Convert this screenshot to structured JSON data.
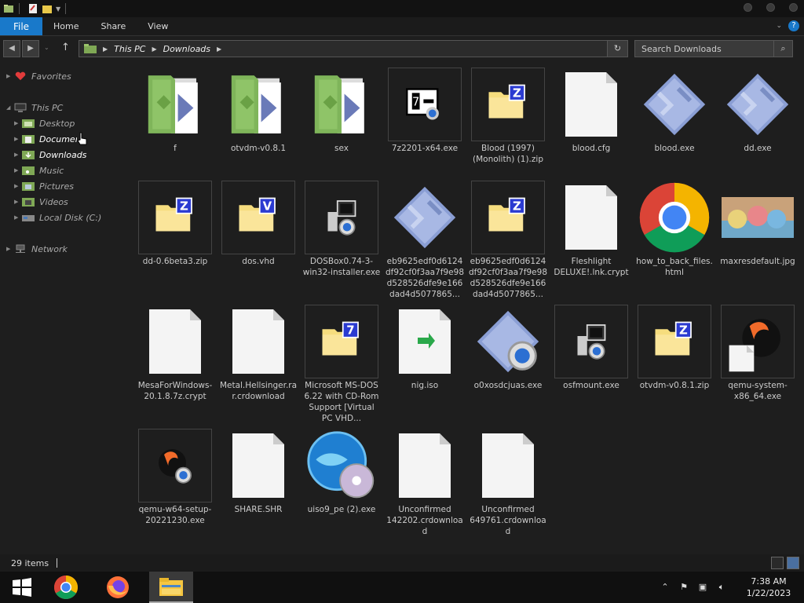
{
  "ribbon": {
    "file": "File",
    "home": "Home",
    "share": "Share",
    "view": "View"
  },
  "address": {
    "root": "This PC",
    "folder": "Downloads"
  },
  "search": {
    "placeholder": "Search Downloads"
  },
  "sidebar": {
    "favorites": "Favorites",
    "this_pc": "This PC",
    "desktop": "Desktop",
    "documents": "Documents",
    "downloads": "Downloads",
    "music": "Music",
    "pictures": "Pictures",
    "videos": "Videos",
    "local_disk": "Local Disk (C:)",
    "network": "Network"
  },
  "files": [
    {
      "name": "f",
      "type": "folder"
    },
    {
      "name": "otvdm-v0.8.1",
      "type": "folder"
    },
    {
      "name": "sex",
      "type": "folder"
    },
    {
      "name": "7z2201-x64.exe",
      "type": "7z-installer"
    },
    {
      "name": "Blood (1997)(Monolith) (1).zip",
      "type": "zip"
    },
    {
      "name": "blood.cfg",
      "type": "blank"
    },
    {
      "name": "blood.exe",
      "type": "exe"
    },
    {
      "name": "dd.exe",
      "type": "exe"
    },
    {
      "name": "dd-0.6beta3.zip",
      "type": "zip"
    },
    {
      "name": "dos.vhd",
      "type": "vhd"
    },
    {
      "name": "DOSBox0.74-3-win32-installer.exe",
      "type": "installer"
    },
    {
      "name": "eb9625edf0d6124df92cf0f3aa7f9e98d528526dfe9e166dad4d5077865...",
      "type": "exe"
    },
    {
      "name": "eb9625edf0d6124df92cf0f3aa7f9e98d528526dfe9e166dad4d5077865...",
      "type": "zip"
    },
    {
      "name": "Fleshlight DELUXE!.lnk.crypt",
      "type": "blank"
    },
    {
      "name": "how_to_back_files.html",
      "type": "chrome"
    },
    {
      "name": "maxresdefault.jpg",
      "type": "image"
    },
    {
      "name": "MesaForWindows-20.1.8.7z.crypt",
      "type": "blank"
    },
    {
      "name": "Metal.Hellsinger.rar.crdownload",
      "type": "blank"
    },
    {
      "name": "Microsoft MS-DOS 6.22 with CD-Rom Support [Virtual PC VHD...",
      "type": "7z-zip"
    },
    {
      "name": "nig.iso",
      "type": "iso"
    },
    {
      "name": "o0xosdcjuas.exe",
      "type": "exe-gear"
    },
    {
      "name": "osfmount.exe",
      "type": "installer"
    },
    {
      "name": "otvdm-v0.8.1.zip",
      "type": "zip"
    },
    {
      "name": "qemu-system-x86_64.exe",
      "type": "qemu"
    },
    {
      "name": "qemu-w64-setup-20221230.exe",
      "type": "qemu-setup"
    },
    {
      "name": "SHARE.SHR",
      "type": "blank"
    },
    {
      "name": "uiso9_pe (2).exe",
      "type": "ultraiso"
    },
    {
      "name": "Unconfirmed 142202.crdownload",
      "type": "blank"
    },
    {
      "name": "Unconfirmed 649761.crdownload",
      "type": "blank"
    }
  ],
  "status": {
    "count": "29 items"
  },
  "clock": {
    "time": "7:38 AM",
    "date": "1/22/2023"
  },
  "colors": {
    "accent": "#1979ca",
    "background": "#1e1e1e",
    "folder_green": "#7fb55a"
  }
}
